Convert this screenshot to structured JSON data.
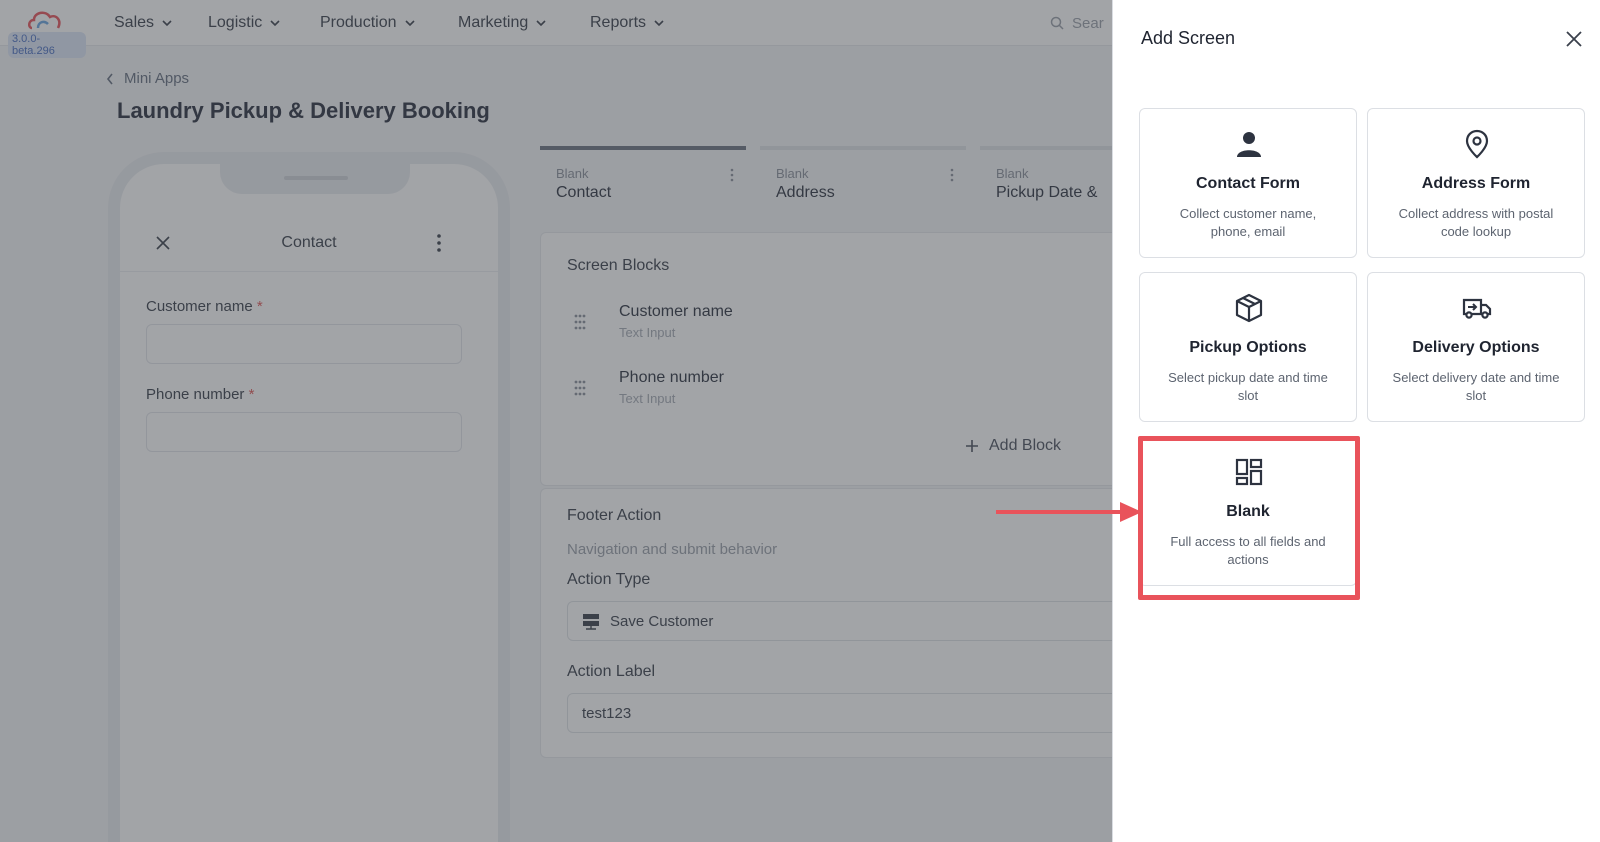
{
  "app": {
    "version": "3.0.0-beta.296",
    "nav": [
      "Sales",
      "Logistic",
      "Production",
      "Marketing",
      "Reports"
    ],
    "search_placeholder": "Sear"
  },
  "page": {
    "breadcrumb": "Mini Apps",
    "title": "Laundry Pickup & Delivery Booking"
  },
  "preview": {
    "screen_title": "Contact",
    "fields": [
      {
        "label": "Customer name",
        "required": "*"
      },
      {
        "label": "Phone number",
        "required": "*"
      }
    ]
  },
  "tabs": [
    {
      "type": "Blank",
      "name": "Contact"
    },
    {
      "type": "Blank",
      "name": "Address"
    },
    {
      "type": "Blank",
      "name": "Pickup Date &"
    }
  ],
  "screen_blocks": {
    "title": "Screen Blocks",
    "items": [
      {
        "name": "Customer name",
        "type": "Text Input"
      },
      {
        "name": "Phone number",
        "type": "Text Input"
      }
    ],
    "add_label": "Add Block"
  },
  "footer_action": {
    "title": "Footer Action",
    "subtitle": "Navigation and submit behavior",
    "action_type_label": "Action Type",
    "action_type_value": "Save Customer",
    "action_label_label": "Action Label",
    "action_label_value": "test123"
  },
  "drawer": {
    "title": "Add Screen",
    "templates": [
      {
        "title": "Contact Form",
        "desc": "Collect customer name, phone, email",
        "icon": "person-icon"
      },
      {
        "title": "Address Form",
        "desc": "Collect address with postal code lookup",
        "icon": "map-pin-icon"
      },
      {
        "title": "Pickup Options",
        "desc": "Select pickup date and time slot",
        "icon": "package-icon"
      },
      {
        "title": "Delivery Options",
        "desc": "Select delivery date and time slot",
        "icon": "truck-icon"
      },
      {
        "title": "Blank",
        "desc": "Full access to all fields and actions",
        "icon": "dashboard-icon"
      }
    ]
  },
  "colors": {
    "highlight": "#e9535b",
    "overlay": "rgba(60,64,72,0.48)"
  }
}
